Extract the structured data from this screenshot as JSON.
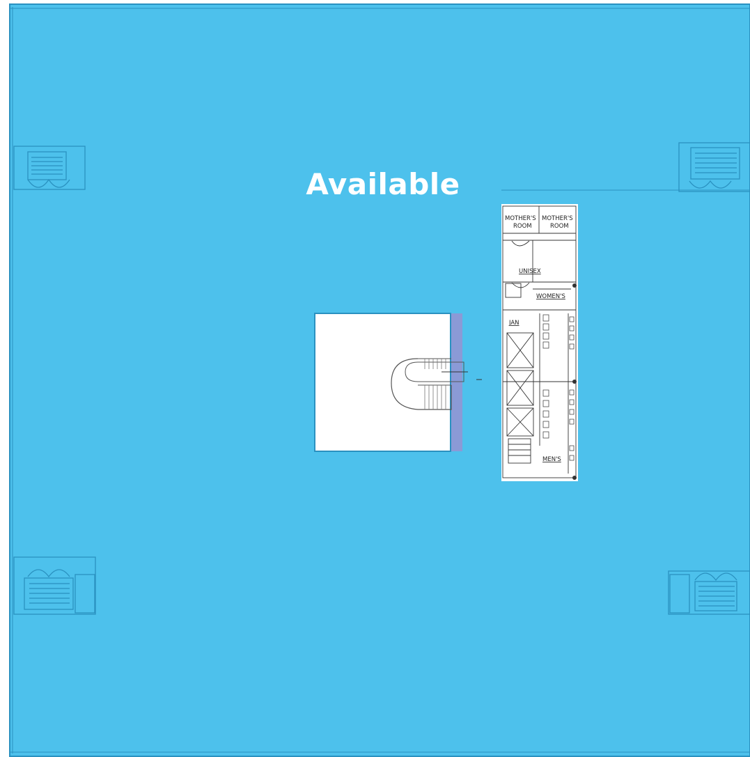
{
  "floor_plan": {
    "space_status": "Available",
    "core_labels": {
      "mothers_room_1": "MOTHER'S",
      "mothers_room_2": "MOTHER'S",
      "room_1": "ROOM",
      "room_2": "ROOM",
      "unisex": "UNISEX",
      "womens": "WOMEN'S",
      "jan": "JAN",
      "mens": "MEN'S"
    }
  },
  "colors": {
    "available_fill": "#4dc1ec",
    "wall_line": "#2a91c0",
    "core_bg": "#ffffff",
    "ink": "#222222"
  }
}
